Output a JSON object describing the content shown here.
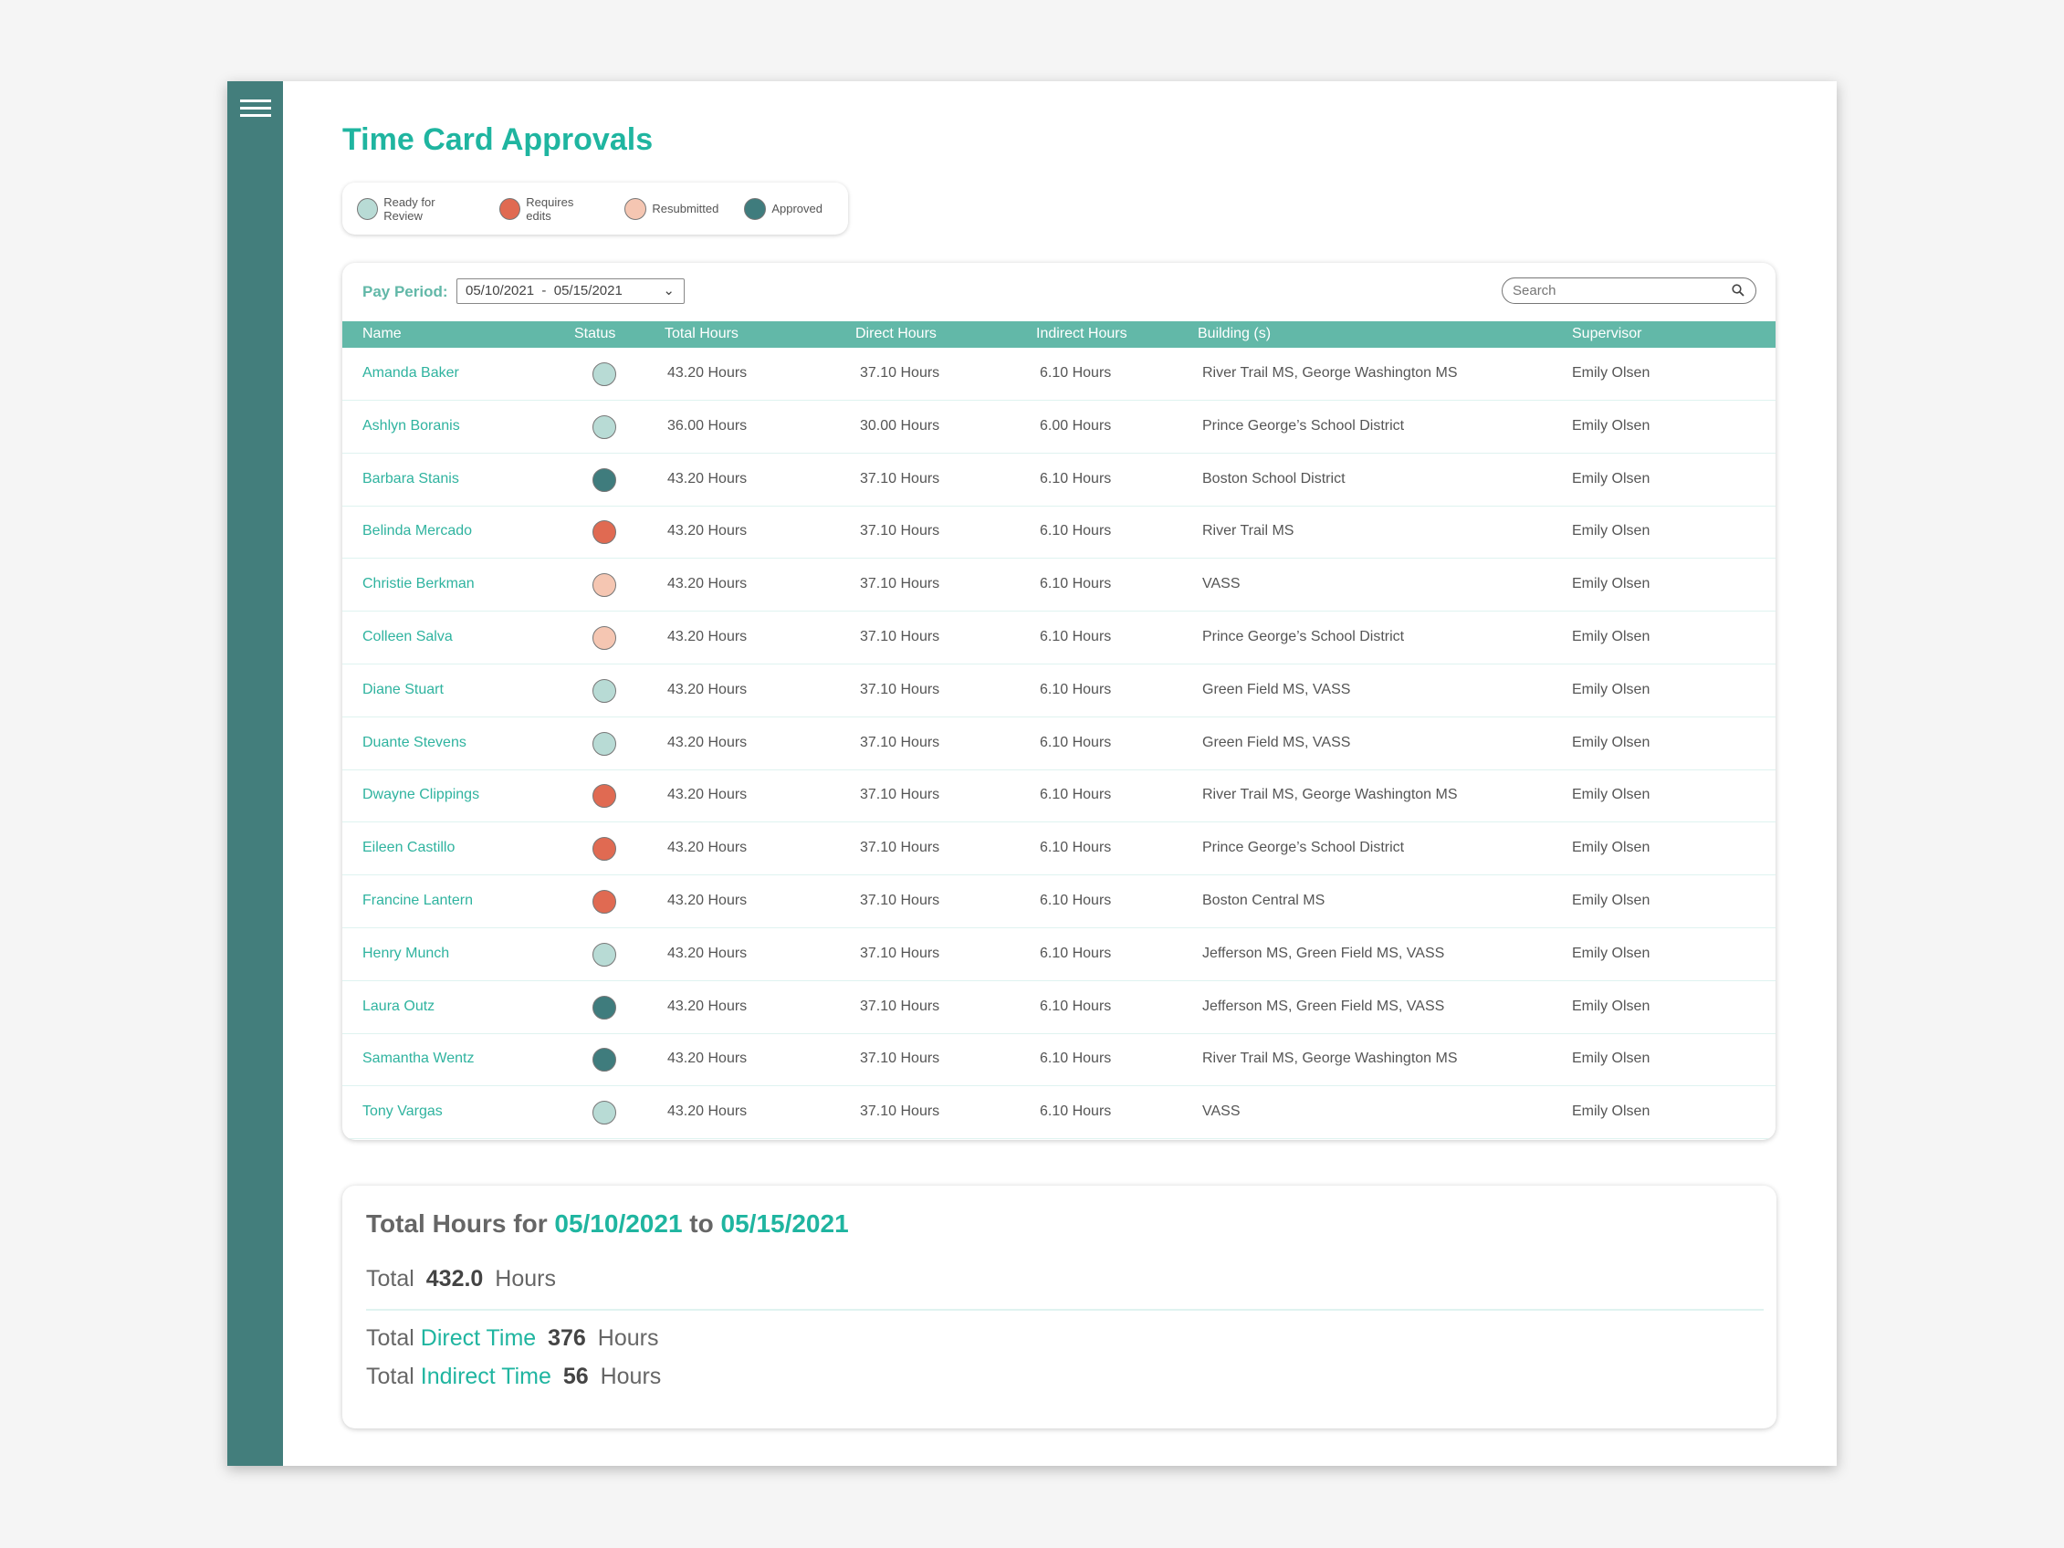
{
  "page": {
    "title": "Time Card Approvals"
  },
  "colors": {
    "accent": "#1fb5a0",
    "sidebar": "#437e7c",
    "header": "#62b8a8"
  },
  "statuses": {
    "ready": {
      "label": "Ready for Review",
      "color": "#b8dbd5"
    },
    "edits": {
      "label": "Requires edits",
      "color": "#e06a52"
    },
    "resub": {
      "label": "Resubmitted",
      "color": "#f5c6b2"
    },
    "approved": {
      "label": "Approved",
      "color": "#3f7c7d"
    }
  },
  "filters": {
    "pay_period_label": "Pay Period:",
    "pay_period_value": "05/10/2021  -  05/15/2021",
    "search_placeholder": "Search"
  },
  "table": {
    "columns": [
      "Name",
      "Status",
      "Total Hours",
      "Direct Hours",
      "Indirect Hours",
      "Building (s)",
      "Supervisor"
    ],
    "rows": [
      {
        "name": "Amanda Baker",
        "status": "ready",
        "total": "43.20 Hours",
        "direct": "37.10 Hours",
        "indirect": "6.10 Hours",
        "building": "River Trail MS, George Washington MS",
        "supervisor": "Emily Olsen"
      },
      {
        "name": "Ashlyn Boranis",
        "status": "ready",
        "total": "36.00 Hours",
        "direct": "30.00 Hours",
        "indirect": "6.00 Hours",
        "building": "Prince George’s School District",
        "supervisor": "Emily Olsen"
      },
      {
        "name": "Barbara Stanis",
        "status": "approved",
        "total": "43.20 Hours",
        "direct": "37.10 Hours",
        "indirect": "6.10 Hours",
        "building": "Boston School District",
        "supervisor": "Emily Olsen"
      },
      {
        "name": "Belinda Mercado",
        "status": "edits",
        "total": "43.20 Hours",
        "direct": "37.10 Hours",
        "indirect": "6.10 Hours",
        "building": "River Trail MS",
        "supervisor": "Emily Olsen"
      },
      {
        "name": "Christie Berkman",
        "status": "resub",
        "total": "43.20 Hours",
        "direct": "37.10 Hours",
        "indirect": "6.10 Hours",
        "building": "VASS",
        "supervisor": "Emily Olsen"
      },
      {
        "name": "Colleen Salva",
        "status": "resub",
        "total": "43.20 Hours",
        "direct": "37.10 Hours",
        "indirect": "6.10 Hours",
        "building": "Prince George’s School District",
        "supervisor": "Emily Olsen"
      },
      {
        "name": "Diane Stuart",
        "status": "ready",
        "total": "43.20 Hours",
        "direct": "37.10 Hours",
        "indirect": "6.10 Hours",
        "building": "Green Field MS, VASS",
        "supervisor": "Emily Olsen"
      },
      {
        "name": "Duante Stevens",
        "status": "ready",
        "total": "43.20 Hours",
        "direct": "37.10 Hours",
        "indirect": "6.10 Hours",
        "building": "Green Field MS, VASS",
        "supervisor": "Emily Olsen"
      },
      {
        "name": "Dwayne Clippings",
        "status": "edits",
        "total": "43.20 Hours",
        "direct": "37.10 Hours",
        "indirect": "6.10 Hours",
        "building": "River Trail MS, George Washington MS",
        "supervisor": "Emily Olsen"
      },
      {
        "name": "Eileen Castillo",
        "status": "edits",
        "total": "43.20 Hours",
        "direct": "37.10 Hours",
        "indirect": "6.10 Hours",
        "building": "Prince George’s School District",
        "supervisor": "Emily Olsen"
      },
      {
        "name": "Francine Lantern",
        "status": "edits",
        "total": "43.20 Hours",
        "direct": "37.10 Hours",
        "indirect": "6.10 Hours",
        "building": "Boston Central MS",
        "supervisor": "Emily Olsen"
      },
      {
        "name": "Henry Munch",
        "status": "ready",
        "total": "43.20 Hours",
        "direct": "37.10 Hours",
        "indirect": "6.10 Hours",
        "building": "Jefferson MS, Green Field MS, VASS",
        "supervisor": "Emily Olsen"
      },
      {
        "name": "Laura Outz",
        "status": "approved",
        "total": "43.20 Hours",
        "direct": "37.10 Hours",
        "indirect": "6.10 Hours",
        "building": "Jefferson MS, Green Field MS, VASS",
        "supervisor": "Emily Olsen"
      },
      {
        "name": "Samantha Wentz",
        "status": "approved",
        "total": "43.20 Hours",
        "direct": "37.10 Hours",
        "indirect": "6.10 Hours",
        "building": "River Trail MS, George Washington MS",
        "supervisor": "Emily Olsen"
      },
      {
        "name": "Tony Vargas",
        "status": "ready",
        "total": "43.20 Hours",
        "direct": "37.10 Hours",
        "indirect": "6.10 Hours",
        "building": "VASS",
        "supervisor": "Emily Olsen"
      }
    ]
  },
  "summary": {
    "heading_prefix": "Total Hours for",
    "start": "05/10/2021",
    "to": "to",
    "end": "05/15/2021",
    "total_label": "Total",
    "total_value": "432.0",
    "hours": "Hours",
    "direct_label": "Direct Time",
    "direct_value": "376",
    "indirect_label": "Indirect Time",
    "indirect_value": "56"
  }
}
